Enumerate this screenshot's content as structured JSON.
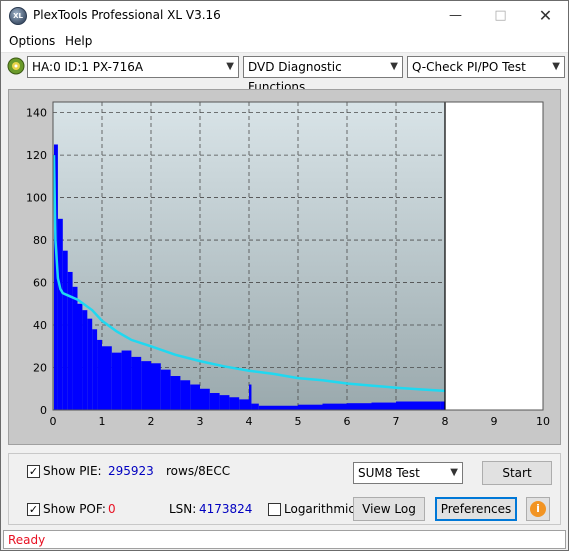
{
  "window": {
    "title": "PlexTools Professional XL V3.16",
    "app_icon_text": "XL"
  },
  "menu": {
    "options": "Options",
    "help": "Help"
  },
  "toolbar": {
    "drive": "HA:0 ID:1  PX-716A",
    "function": "DVD Diagnostic Functions",
    "test": "Q-Check PI/PO Test"
  },
  "chart_data": {
    "type": "bar",
    "xlim": [
      0,
      10
    ],
    "ylim": [
      0,
      145
    ],
    "x_ticks": [
      "0",
      "1",
      "2",
      "3",
      "4",
      "5",
      "6",
      "7",
      "8",
      "9",
      "10"
    ],
    "y_ticks": [
      "0",
      "20",
      "40",
      "60",
      "80",
      "100",
      "120",
      "140"
    ],
    "grid": true,
    "written_end_x": 8.0,
    "series": [
      {
        "color": "#0000ff",
        "x": [
          0.02,
          0.1,
          0.2,
          0.3,
          0.4,
          0.5,
          0.6,
          0.7,
          0.8,
          0.9,
          1.0,
          1.2,
          1.4,
          1.6,
          1.8,
          2.0,
          2.2,
          2.4,
          2.6,
          2.8,
          3.0,
          3.2,
          3.4,
          3.6,
          3.8,
          4.0,
          4.05,
          4.2,
          4.5,
          5.0,
          5.5,
          6.0,
          6.5,
          7.0,
          7.5,
          7.9
        ],
        "values": [
          125,
          90,
          75,
          65,
          58,
          50,
          47,
          43,
          38,
          33,
          30,
          27,
          28,
          25,
          23,
          22,
          19,
          16,
          14,
          12,
          10,
          8,
          7,
          6,
          5,
          12,
          3,
          2,
          2,
          2.5,
          3,
          3.2,
          3.5,
          4,
          4,
          4
        ]
      },
      {
        "color": "#20d8f0",
        "x": [
          0.02,
          0.05,
          0.1,
          0.15,
          0.2,
          0.3,
          0.5,
          0.8,
          1.0,
          1.3,
          1.6,
          2.0,
          2.5,
          3.0,
          3.5,
          4.0,
          4.5,
          5.0,
          5.5,
          6.0,
          6.5,
          7.0,
          7.5,
          8.0
        ],
        "values": [
          120,
          80,
          62,
          57,
          55,
          54,
          52,
          47,
          42,
          37,
          33,
          30,
          26,
          23,
          20.5,
          18.5,
          17,
          15,
          14,
          12.5,
          11.5,
          10.5,
          9.7,
          9.0
        ]
      }
    ]
  },
  "controls": {
    "show_pie_label": "Show PIE:",
    "pie_value": "295923",
    "pie_unit": "rows/8ECC",
    "show_pof_label": "Show POF:",
    "pof_value": "0",
    "lsn_label": "LSN:",
    "lsn_value": "4173824",
    "logarithmic_label": "Logarithmic",
    "sum_test": "SUM8 Test",
    "start": "Start",
    "view_log": "View Log",
    "preferences": "Preferences",
    "show_pie_checked": true,
    "show_pof_checked": true,
    "logarithmic_checked": false
  },
  "status": {
    "text": "Ready",
    "color": "#e81123"
  }
}
